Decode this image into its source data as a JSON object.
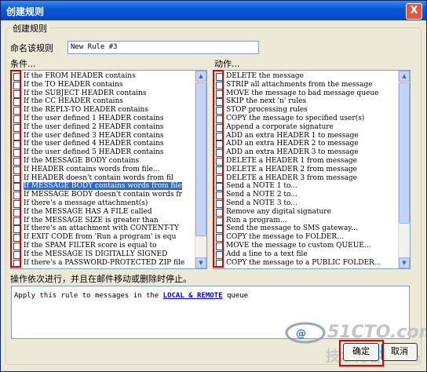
{
  "window": {
    "title": "创建规则",
    "close_glyph": "X"
  },
  "group": {
    "label": "创建规则"
  },
  "rule_name": {
    "label": "命名该规则",
    "value": "New Rule #3"
  },
  "conditions": {
    "label": "条件...",
    "items": [
      "If the FROM HEADER contains",
      "If the TO HEADER contains",
      "If the SUBJECT HEADER contains",
      "If the CC HEADER contains",
      "If the REPLY-TO HEADER contains",
      "If the user defined 1 HEADER contains",
      "If the user defined 2 HEADER contains",
      "If the user defined 3 HEADER contains",
      "If the user defined 4 HEADER contains",
      "If the user defined 5 HEADER contains",
      "If the MESSAGE BODY contains",
      "If HEADER contains words from file...",
      "If HEADER doesn't contain words from fil",
      "If MESSAGE BODY contains words from file",
      "If MESSAGE BODY doesn't contain words fr",
      "If there's a message attachment(s)",
      "If the MESSAGE HAS A FILE called",
      "If the MESSAGE SIZE is greater than",
      "If there's an attachment with CONTENT-TY",
      "If EXIT CODE from 'Run a program' is equ",
      "If the SPAM FILTER score is equal to",
      "If the MESSAGE IS DIGITALLY SIGNED",
      "If there's a PASSWORD-PROTECTED ZIP file"
    ],
    "selected_index": 13
  },
  "actions": {
    "label": "动作...",
    "items": [
      "DELETE the message",
      "STRIP all attachments from the message",
      "MOVE the message to bad message queue",
      "SKIP the next 'n' rules",
      "STOP processing rules",
      "COPY the message to specified user(s)",
      "Append a corporate signature",
      "ADD an extra HEADER 1 to message",
      "ADD an extra HEADER 2 to message",
      "ADD an extra HEADER 3 to message",
      "DELETE a HEADER 1 from message",
      "DELETE a HEADER 2 from message",
      "DELETE a HEADER 3 from message",
      "Send a NOTE 1 to...",
      "Send a NOTE 2 to...",
      "Send a NOTE 3 to...",
      "Remove any digital signature",
      "Run a program...",
      "Send the message to SMS gateway...",
      "COPY the message to FOLDER...",
      "MOVE the message to custom QUEUE...",
      "Add a line to a text file",
      "COPY the message to a PUBLIC FOLDER..."
    ]
  },
  "note": "操作依次进行，并且在邮件移动或删除时停止。",
  "description": {
    "before": "Apply this rule to messages in the",
    "link": "LOCAL & REMOTE",
    "after": "queue"
  },
  "buttons": {
    "ok": "确定",
    "cancel": "取消"
  },
  "watermark": {
    "site": "51CTO.com",
    "sub": "技术博客",
    "blog": "Blog"
  },
  "colors": {
    "title_bar": "#0a58d8",
    "selection": "#316ac5",
    "highlight_box": "#e00000",
    "link": "#0000cc"
  }
}
